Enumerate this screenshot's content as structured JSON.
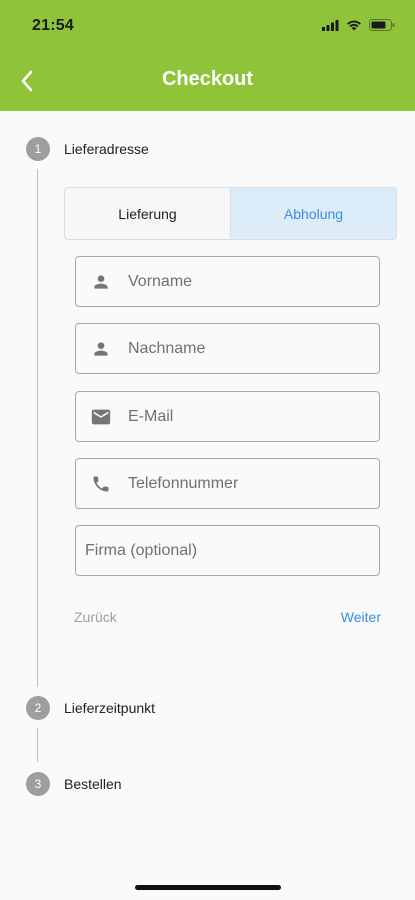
{
  "status_bar": {
    "time": "21:54"
  },
  "header": {
    "title": "Checkout"
  },
  "steps": [
    {
      "number": "1",
      "label": "Lieferadresse"
    },
    {
      "number": "2",
      "label": "Lieferzeitpunkt"
    },
    {
      "number": "3",
      "label": "Bestellen"
    }
  ],
  "delivery_toggle": {
    "options": [
      "Lieferung",
      "Abholung"
    ],
    "selected": "Abholung"
  },
  "form": {
    "first_name_placeholder": "Vorname",
    "last_name_placeholder": "Nachname",
    "email_placeholder": "E-Mail",
    "phone_placeholder": "Telefonnummer",
    "company_placeholder": "Firma (optional)"
  },
  "actions": {
    "back_label": "Zurück",
    "next_label": "Weiter"
  },
  "colors": {
    "header": "#8fc43a",
    "accent": "#3b8ee0",
    "step": "#9e9e9e"
  }
}
